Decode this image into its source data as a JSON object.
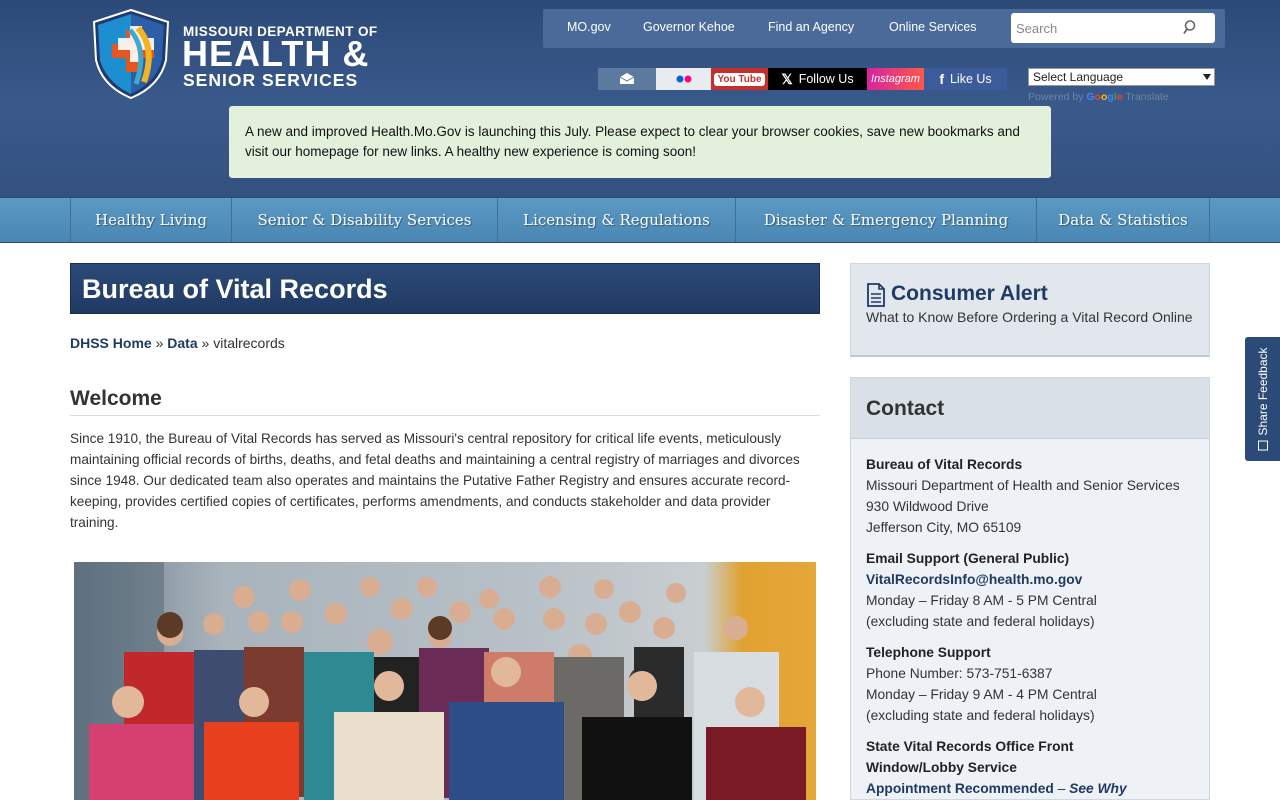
{
  "header": {
    "logo_line1": "MISSOURI DEPARTMENT OF",
    "logo_line2": "HEALTH &",
    "logo_line3": "SENIOR SERVICES",
    "top_links": [
      "MO.gov",
      "Governor Kehoe",
      "Find an Agency",
      "Online Services"
    ],
    "search_placeholder": "Search",
    "social": {
      "youtube": "You Tube",
      "x": "Follow Us",
      "instagram": "Instagram",
      "facebook": "Like Us"
    },
    "language_select": "Select Language",
    "powered_by": "Powered by",
    "google": "Google",
    "translate": "Translate",
    "notice": "A new and improved Health.Mo.Gov is launching this July. Please expect to clear your browser cookies, save new bookmarks and visit our homepage for new links. A healthy new experience is coming soon!"
  },
  "nav": [
    "Healthy Living",
    "Senior & Disability Services",
    "Licensing & Regulations",
    "Disaster & Emergency Planning",
    "Data & Statistics"
  ],
  "main": {
    "title": "Bureau of Vital Records",
    "breadcrumb": {
      "home": "DHSS Home",
      "sep": " » ",
      "data": "Data",
      "current": "vitalrecords"
    },
    "welcome": "Welcome",
    "intro": "Since 1910, the Bureau of Vital Records has served as Missouri's central repository for critical life events, meticulously maintaining official records of births, deaths, and fetal deaths and maintaining a central registry of marriages and divorces since 1948. Our dedicated team also operates and maintains the Putative Father Registry and ensures accurate record-keeping, provides certified copies of certificates, performs amendments, and conducts stakeholder and data provider training."
  },
  "sidebar": {
    "alert_title": "Consumer Alert",
    "alert_sub": "What to Know Before Ordering a Vital Record Online",
    "contact_title": "Contact",
    "bureau": "Bureau of Vital Records",
    "dept": "Missouri Department of Health and Senior Services",
    "address1": "930 Wildwood Drive",
    "address2": "Jefferson City, MO 65109",
    "email_head": "Email Support (General Public)",
    "email": "VitalRecordsInfo@health.mo.gov",
    "email_hours": "Monday – Friday 8 AM - 5 PM Central",
    "email_note": "(excluding state and federal holidays)",
    "phone_head": "Telephone Support",
    "phone": "Phone Number: 573-751-6387",
    "phone_hours": "Monday – Friday 9 AM - 4 PM Central",
    "phone_note": "(excluding state and federal holidays)",
    "office_head": "State Vital Records Office Front Window/Lobby Service",
    "office_appt": "Appointment Recommended",
    "office_dash": " – ",
    "office_why": "See Why"
  },
  "feedback": "Share Feedback"
}
